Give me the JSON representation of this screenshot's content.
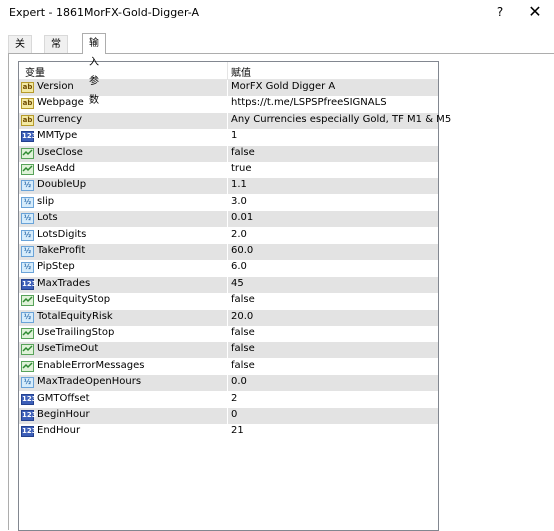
{
  "window": {
    "title": "Expert - 1861MorFX-Gold-Digger-A",
    "help": "?",
    "close": "✕"
  },
  "tabs": [
    "关于",
    "常用",
    "输入参数"
  ],
  "columns": {
    "variable": "变量",
    "value": "赋值"
  },
  "params": [
    {
      "type": "ab",
      "name": "Version",
      "value": "MorFX Gold Digger A"
    },
    {
      "type": "ab",
      "name": "Webpage",
      "value": "https://t.me/LSPSPfreeSIGNALS"
    },
    {
      "type": "ab",
      "name": "Currency",
      "value": "Any Currencies especially Gold, TF M1 & M5"
    },
    {
      "type": "int",
      "name": "MMType",
      "value": "1"
    },
    {
      "type": "bool",
      "name": "UseClose",
      "value": "false"
    },
    {
      "type": "bool",
      "name": "UseAdd",
      "value": "true"
    },
    {
      "type": "dbl",
      "name": "DoubleUp",
      "value": "1.1"
    },
    {
      "type": "dbl",
      "name": "slip",
      "value": "3.0"
    },
    {
      "type": "dbl",
      "name": "Lots",
      "value": "0.01"
    },
    {
      "type": "dbl",
      "name": "LotsDigits",
      "value": "2.0"
    },
    {
      "type": "dbl",
      "name": "TakeProfit",
      "value": "60.0"
    },
    {
      "type": "dbl",
      "name": "PipStep",
      "value": "6.0"
    },
    {
      "type": "int",
      "name": "MaxTrades",
      "value": "45"
    },
    {
      "type": "bool",
      "name": "UseEquityStop",
      "value": "false"
    },
    {
      "type": "dbl",
      "name": "TotalEquityRisk",
      "value": "20.0"
    },
    {
      "type": "bool",
      "name": "UseTrailingStop",
      "value": "false"
    },
    {
      "type": "bool",
      "name": "UseTimeOut",
      "value": "false"
    },
    {
      "type": "bool",
      "name": "EnableErrorMessages",
      "value": "false"
    },
    {
      "type": "dbl",
      "name": "MaxTradeOpenHours",
      "value": "0.0"
    },
    {
      "type": "int",
      "name": "GMTOffset",
      "value": "2"
    },
    {
      "type": "int",
      "name": "BeginHour",
      "value": "0"
    },
    {
      "type": "int",
      "name": "EndHour",
      "value": "21"
    }
  ],
  "icon_labels": {
    "ab": "ab",
    "int": "123",
    "dbl": "½"
  }
}
